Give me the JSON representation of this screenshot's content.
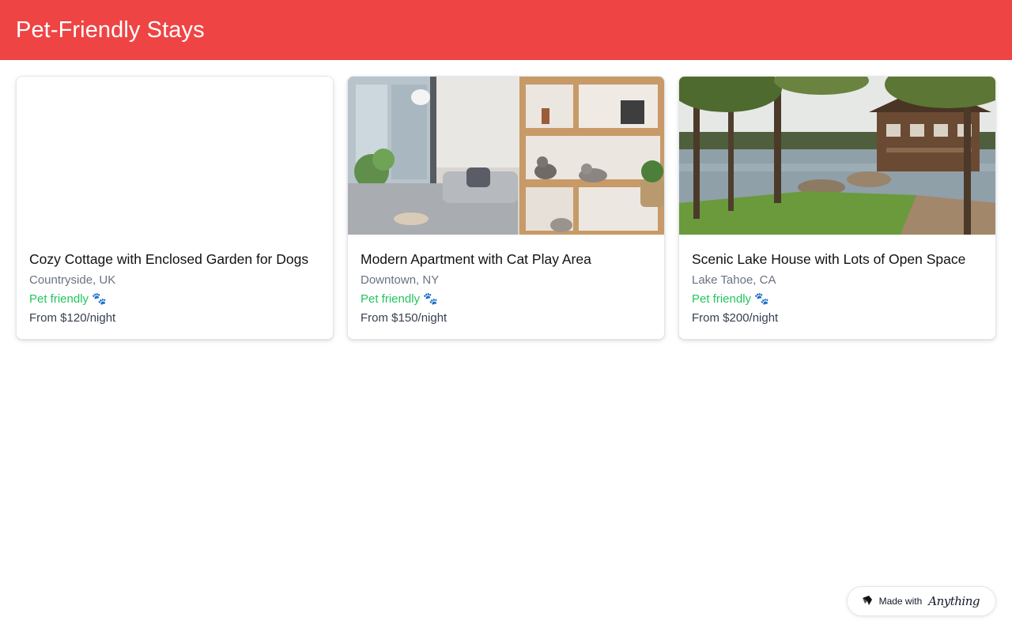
{
  "header": {
    "title": "Pet-Friendly Stays",
    "background_color": "#ef4444"
  },
  "listings": [
    {
      "title": "Cozy Cottage with Enclosed Garden for Dogs",
      "location": "Countryside, UK",
      "pet_label": "Pet friendly",
      "pet_icon": "🐾",
      "price": "From $120/night",
      "image": "blank"
    },
    {
      "title": "Modern Apartment with Cat Play Area",
      "location": "Downtown, NY",
      "pet_label": "Pet friendly",
      "pet_icon": "🐾",
      "price": "From $150/night",
      "image": "apartment-with-cats"
    },
    {
      "title": "Scenic Lake House with Lots of Open Space",
      "location": "Lake Tahoe, CA",
      "pet_label": "Pet friendly",
      "pet_icon": "🐾",
      "price": "From $200/night",
      "image": "lake-house"
    }
  ],
  "badge": {
    "prefix": "Made with",
    "brand": "Anything",
    "icon": "anything-logo-icon"
  },
  "colors": {
    "accent": "#ef4444",
    "pet_friendly": "#22c55e",
    "muted_text": "#6b7280"
  }
}
